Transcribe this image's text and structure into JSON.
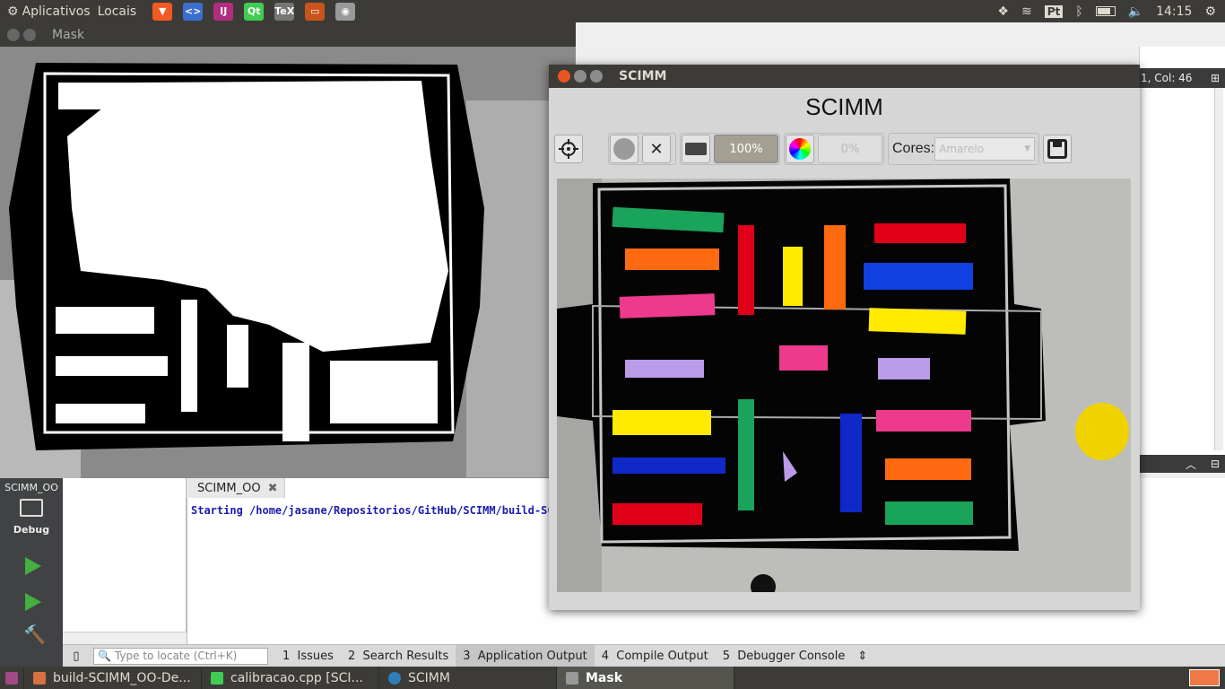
{
  "topbar": {
    "applications": "Aplicativos",
    "places": "Locais",
    "keyboard_layout": "Pt",
    "time": "14:15"
  },
  "mask_window": {
    "title": "Mask"
  },
  "scimm_window": {
    "title": "SCIMM",
    "heading": "SCIMM",
    "progress_1": "100%",
    "progress_2": "0%",
    "cores_label": "Cores:",
    "cores_selected": "Amarelo"
  },
  "editor": {
    "line_col": "1, Col: 46"
  },
  "left_mode": {
    "project": "SCIMM_OO",
    "mode": "Debug"
  },
  "output": {
    "tab_label": "SCIMM_OO",
    "text": "Starting /home/jasane/Repositorios/GitHub/SCIMM/build-SC"
  },
  "bottombar": {
    "locate_placeholder": "Type to locate (Ctrl+K)",
    "tabs": [
      {
        "num": "1",
        "label": "Issues"
      },
      {
        "num": "2",
        "label": "Search Results"
      },
      {
        "num": "3",
        "label": "Application Output"
      },
      {
        "num": "4",
        "label": "Compile Output"
      },
      {
        "num": "5",
        "label": "Debugger Console"
      }
    ]
  },
  "taskbar": {
    "items": [
      {
        "label": "build-SCIMM_OO-De..."
      },
      {
        "label": "calibracao.cpp [SCI..."
      },
      {
        "label": "SCIMM"
      },
      {
        "label": "Mask"
      }
    ]
  },
  "colors": {
    "panel": "#3c3b37",
    "accent": "#f07746",
    "output_text": "#1c1cb2"
  }
}
